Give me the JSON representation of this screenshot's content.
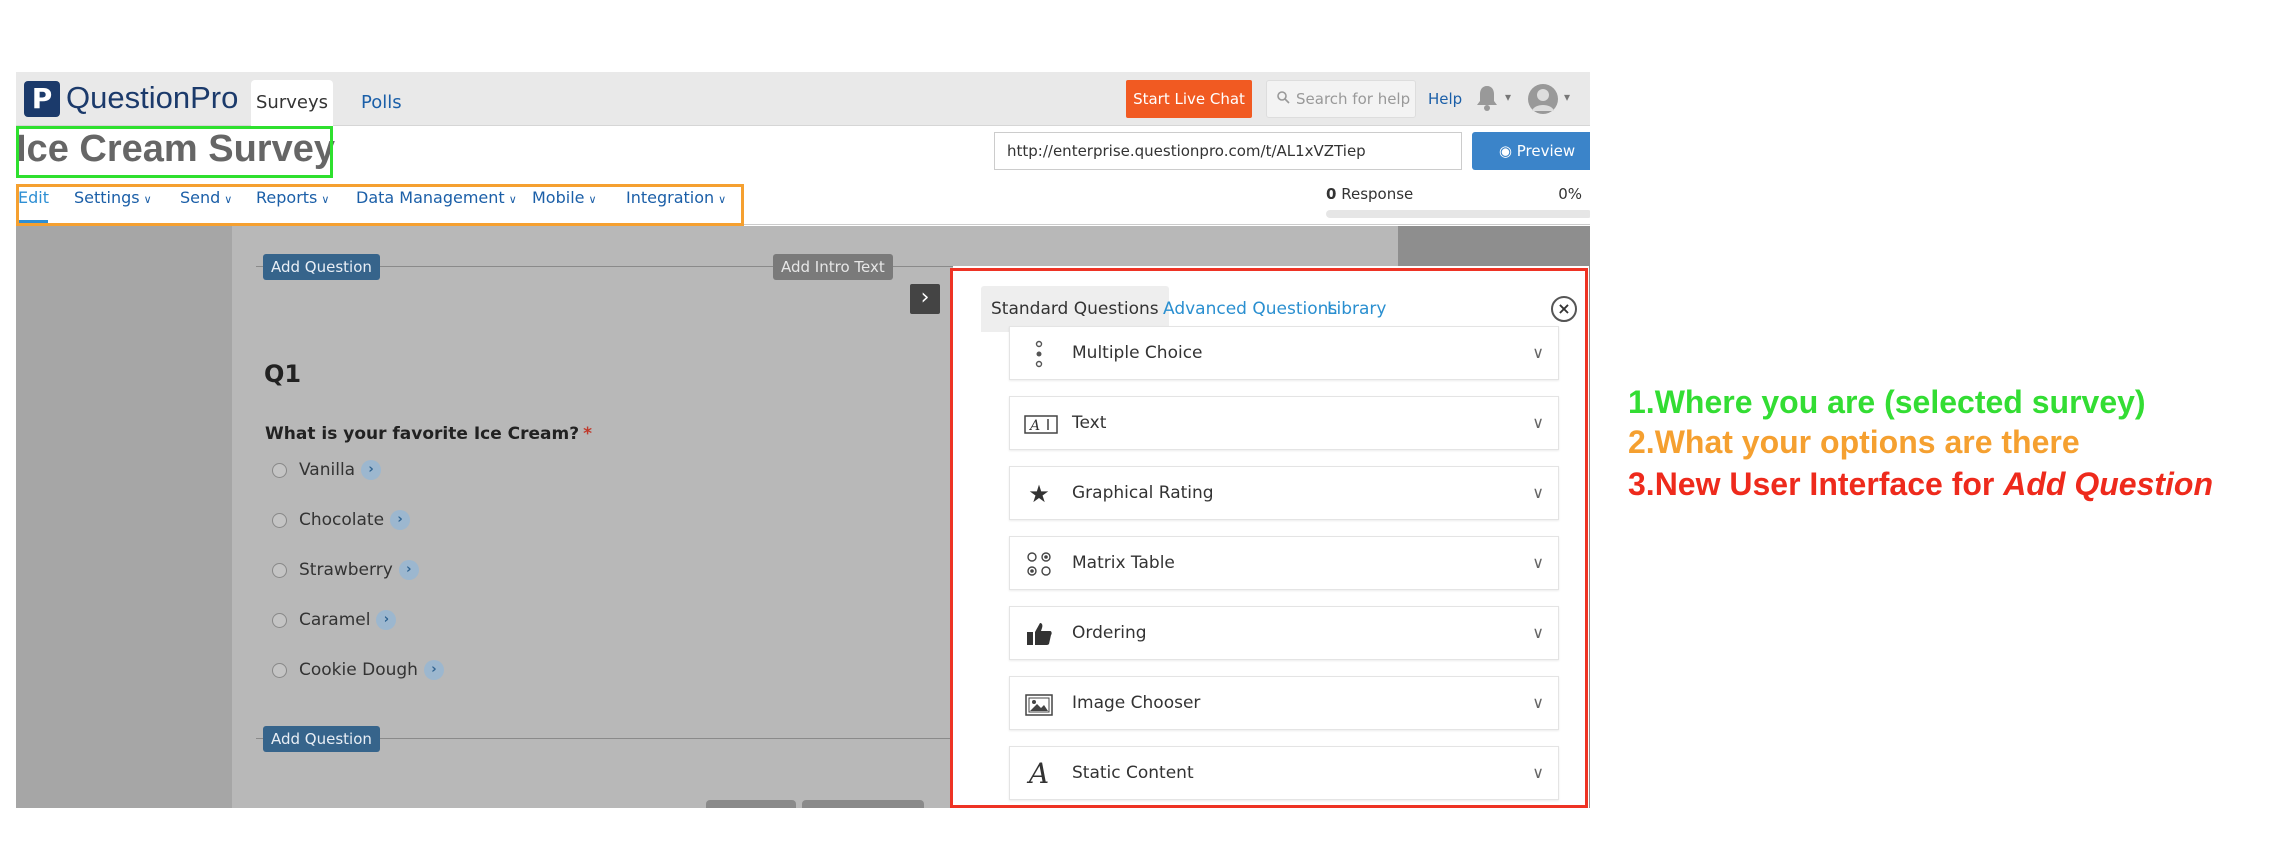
{
  "header": {
    "logo_mark": "P",
    "logo_text": "QuestionPro",
    "tabs": [
      {
        "label": "Surveys",
        "active": true
      },
      {
        "label": "Polls",
        "active": false
      }
    ],
    "live_chat_label": "Start Live Chat",
    "search_placeholder": "Search for help",
    "help_label": "Help",
    "icons": {
      "search": "search-icon",
      "bell": "bell-icon",
      "avatar": "user-avatar-icon"
    }
  },
  "survey": {
    "title": "Ice Cream Survey",
    "url": "http://enterprise.questionpro.com/t/AL1xVZTiep",
    "preview_label": "Preview",
    "response_count": "0",
    "response_label": "Response",
    "response_percent": "0%",
    "response_fraction": 0
  },
  "menu": {
    "items": [
      "Edit",
      "Settings",
      "Send",
      "Reports",
      "Data Management",
      "Mobile",
      "Integration"
    ]
  },
  "editor": {
    "add_question_label": "Add Question",
    "add_intro_label": "Add Intro Text",
    "question_number": "Q1",
    "question_text": "What is your favorite Ice Cream?",
    "required_mark": "*",
    "options": [
      "Vanilla",
      "Chocolate",
      "Strawberry",
      "Caramel",
      "Cookie Dough"
    ]
  },
  "add_question_panel": {
    "tabs": [
      {
        "label": "Standard Questions",
        "active": true
      },
      {
        "label": "Advanced Questions",
        "active": false
      },
      {
        "label": "Library",
        "active": false
      }
    ],
    "question_types": [
      {
        "label": "Multiple Choice",
        "icon": "multiple-choice-icon"
      },
      {
        "label": "Text",
        "icon": "text-field-icon"
      },
      {
        "label": "Graphical Rating",
        "icon": "star-icon"
      },
      {
        "label": "Matrix Table",
        "icon": "matrix-icon"
      },
      {
        "label": "Ordering",
        "icon": "thumbs-up-icon"
      },
      {
        "label": "Image Chooser",
        "icon": "image-icon"
      },
      {
        "label": "Static Content",
        "icon": "static-text-icon"
      }
    ]
  },
  "annotations": {
    "line1": "1.Where you are (selected survey)",
    "line2": "2.What your options are there",
    "line3_prefix": "3.New User Interface for ",
    "line3_emphasis": "Add Question"
  },
  "colors": {
    "brand": "#1b3a6b",
    "link": "#1b5fa8",
    "live_chat": "#f15a22",
    "preview": "#3b84c9",
    "highlight_green": "#2ee02e",
    "highlight_orange": "#f5a030",
    "highlight_red": "#ee3324"
  }
}
